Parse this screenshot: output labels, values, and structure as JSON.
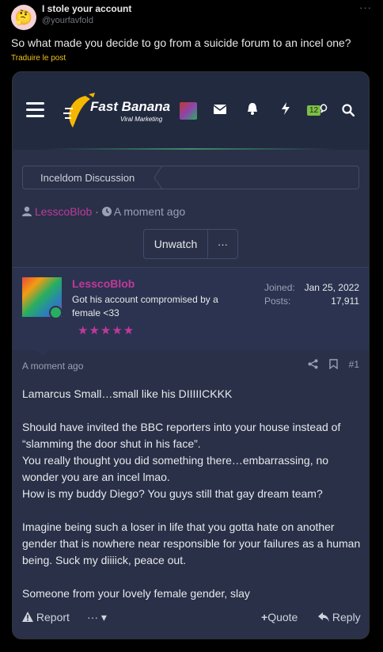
{
  "tweet": {
    "avatar_emoji": "🤔",
    "name": "I stole your account",
    "handle": "@yourfavfold",
    "more": "···",
    "text": "So what made you decide to go from a suicide forum to an incel one?",
    "translate": "Traduire le post"
  },
  "forum": {
    "logo_title": "Fast Banana",
    "logo_sub": "Viral Marketing",
    "badge": "12",
    "breadcrumb": "Inceldom Discussion",
    "thread_author": "LesscoBlob",
    "thread_time": "A moment ago",
    "unwatch_label": "Unwatch",
    "more_label": "···",
    "post": {
      "username": "LesscoBlob",
      "user_title": "Got his account compromised by a female <33",
      "stars": "★★★★★",
      "joined_label": "Joined:",
      "joined_value": "Jan 25, 2022",
      "posts_label": "Posts:",
      "posts_value": "17,911",
      "time": "A moment ago",
      "post_number": "#1",
      "paragraphs": [
        "Lamarcus Small…small like his DIIIIICKKK",
        "Should have invited the BBC reporters into your house instead of “slamming the door shut in his face”.\nYou really thought you did something there…embarrassing, no wonder you are an incel lmao.\nHow is my buddy Diego? You guys still that gay dream team?",
        "Imagine being such a loser in life that you gotta hate on another gender that is nowhere near responsible for your failures as a human being. Suck my diiiick, peace out.",
        "Someone from your lovely female gender, slay"
      ],
      "report_label": "Report",
      "more_actions": "··· ▾",
      "quote_label": "Quote",
      "reply_label": "Reply"
    }
  },
  "colors": {
    "accent": "#c0399a",
    "card_bg": "#293048",
    "nav_bg": "#222a40",
    "badge_bg": "#7bc043",
    "online": "#27ae60"
  }
}
